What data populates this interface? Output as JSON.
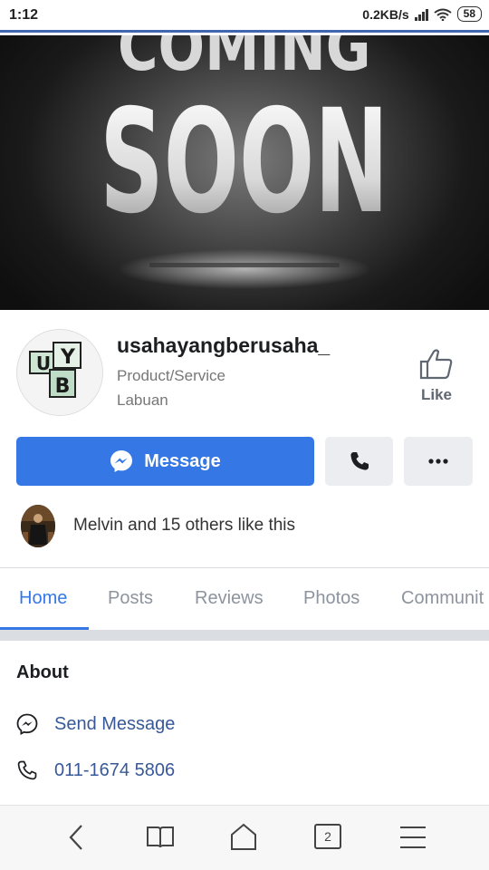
{
  "status_bar": {
    "time": "1:12",
    "speed": "0.2KB/s",
    "battery": "58",
    "icons": [
      "signal-icon",
      "wifi-icon",
      "battery-icon"
    ]
  },
  "cover": {
    "line1": "COMING",
    "line2": "SOON"
  },
  "page": {
    "name": "usahayangberusaha_",
    "category": "Product/Service",
    "location": "Labuan",
    "like_label": "Like",
    "avatar_letters": [
      "U",
      "Y",
      "B"
    ]
  },
  "actions": {
    "message_label": "Message",
    "call_icon": "phone-icon",
    "more_icon": "more-icon"
  },
  "likes": {
    "text": "Melvin and 15 others like this"
  },
  "tabs": [
    {
      "label": "Home",
      "active": true
    },
    {
      "label": "Posts",
      "active": false
    },
    {
      "label": "Reviews",
      "active": false
    },
    {
      "label": "Photos",
      "active": false
    },
    {
      "label": "Communit",
      "active": false
    }
  ],
  "about": {
    "title": "About",
    "send_message": "Send Message",
    "phone": "011-1674 5806"
  },
  "bottom_nav": {
    "tab_count": "2",
    "icons": [
      "back-icon",
      "bookmarks-icon",
      "home-icon",
      "tabs-icon",
      "menu-icon"
    ]
  },
  "colors": {
    "accent": "#3578e5",
    "link": "#385898",
    "status_line": "#4267b2"
  }
}
